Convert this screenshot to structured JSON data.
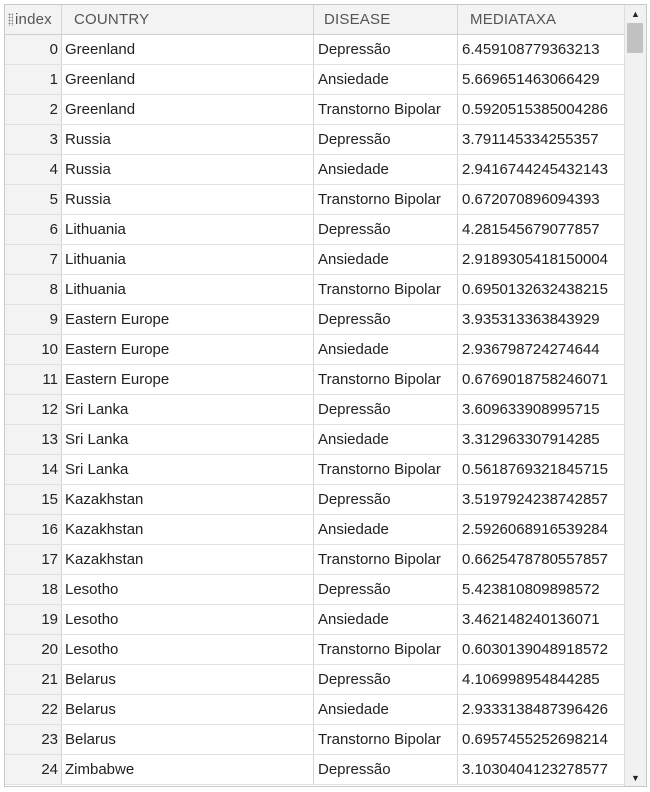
{
  "table": {
    "columns": {
      "index": "index",
      "country": "COUNTRY",
      "disease": "DISEASE",
      "mediataxa": "MEDIATAXA"
    },
    "rows": [
      {
        "index": "0",
        "country": "Greenland",
        "disease": "Depressão",
        "mediataxa": "6.459108779363213"
      },
      {
        "index": "1",
        "country": "Greenland",
        "disease": "Ansiedade",
        "mediataxa": "5.669651463066429"
      },
      {
        "index": "2",
        "country": "Greenland",
        "disease": "Transtorno Bipolar",
        "mediataxa": "0.5920515385004286"
      },
      {
        "index": "3",
        "country": "Russia",
        "disease": "Depressão",
        "mediataxa": "3.791145334255357"
      },
      {
        "index": "4",
        "country": "Russia",
        "disease": "Ansiedade",
        "mediataxa": "2.9416744245432143"
      },
      {
        "index": "5",
        "country": "Russia",
        "disease": "Transtorno Bipolar",
        "mediataxa": "0.672070896094393"
      },
      {
        "index": "6",
        "country": "Lithuania",
        "disease": "Depressão",
        "mediataxa": "4.281545679077857"
      },
      {
        "index": "7",
        "country": "Lithuania",
        "disease": "Ansiedade",
        "mediataxa": "2.9189305418150004"
      },
      {
        "index": "8",
        "country": "Lithuania",
        "disease": "Transtorno Bipolar",
        "mediataxa": "0.6950132632438215"
      },
      {
        "index": "9",
        "country": "Eastern Europe",
        "disease": "Depressão",
        "mediataxa": "3.935313363843929"
      },
      {
        "index": "10",
        "country": "Eastern Europe",
        "disease": "Ansiedade",
        "mediataxa": "2.936798724274644"
      },
      {
        "index": "11",
        "country": "Eastern Europe",
        "disease": "Transtorno Bipolar",
        "mediataxa": "0.6769018758246071"
      },
      {
        "index": "12",
        "country": "Sri Lanka",
        "disease": "Depressão",
        "mediataxa": "3.609633908995715"
      },
      {
        "index": "13",
        "country": "Sri Lanka",
        "disease": "Ansiedade",
        "mediataxa": "3.312963307914285"
      },
      {
        "index": "14",
        "country": "Sri Lanka",
        "disease": "Transtorno Bipolar",
        "mediataxa": "0.5618769321845715"
      },
      {
        "index": "15",
        "country": "Kazakhstan",
        "disease": "Depressão",
        "mediataxa": "3.5197924238742857"
      },
      {
        "index": "16",
        "country": "Kazakhstan",
        "disease": "Ansiedade",
        "mediataxa": "2.5926068916539284"
      },
      {
        "index": "17",
        "country": "Kazakhstan",
        "disease": "Transtorno Bipolar",
        "mediataxa": "0.6625478780557857"
      },
      {
        "index": "18",
        "country": "Lesotho",
        "disease": "Depressão",
        "mediataxa": "5.423810809898572"
      },
      {
        "index": "19",
        "country": "Lesotho",
        "disease": "Ansiedade",
        "mediataxa": "3.462148240136071"
      },
      {
        "index": "20",
        "country": "Lesotho",
        "disease": "Transtorno Bipolar",
        "mediataxa": "0.6030139048918572"
      },
      {
        "index": "21",
        "country": "Belarus",
        "disease": "Depressão",
        "mediataxa": "4.106998954844285"
      },
      {
        "index": "22",
        "country": "Belarus",
        "disease": "Ansiedade",
        "mediataxa": "2.9333138487396426"
      },
      {
        "index": "23",
        "country": "Belarus",
        "disease": "Transtorno Bipolar",
        "mediataxa": "0.6957455252698214"
      },
      {
        "index": "24",
        "country": "Zimbabwe",
        "disease": "Depressão",
        "mediataxa": "3.1030404123278577"
      }
    ]
  },
  "scrollbar": {
    "up_icon": "triangle-up-icon",
    "down_icon": "triangle-down-icon",
    "up_glyph": "▲",
    "down_glyph": "▼"
  }
}
